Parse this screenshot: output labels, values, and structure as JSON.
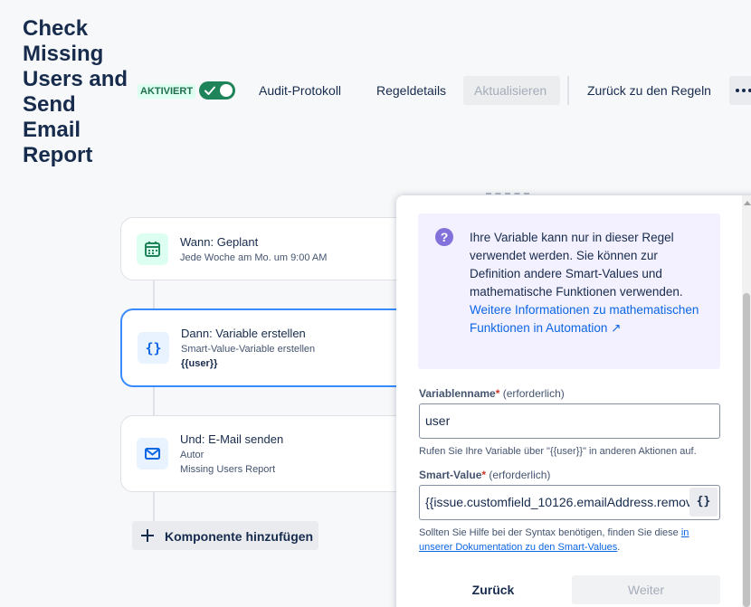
{
  "header": {
    "title": "Check Missing Users and Send Email Report",
    "status_badge": "AKTIVIERT",
    "toggle_on": true,
    "buttons": {
      "audit": "Audit-Protokoll",
      "details": "Regeldetails",
      "update": "Aktualisieren",
      "back": "Zurück zu den Regeln"
    },
    "more_icon": "more-horizontal-icon"
  },
  "flow": {
    "steps": [
      {
        "title": "Wann: Geplant",
        "subtitle": "Jede Woche am Mo. um 9:00 AM",
        "icon": "calendar-icon"
      },
      {
        "title": "Dann: Variable erstellen",
        "subtitle": "Smart-Value-Variable erstellen",
        "detail": "{{user}}",
        "icon": "braces-icon"
      },
      {
        "title": "Und: E-Mail senden",
        "subtitle": "Autor",
        "detail": "Missing Users Report",
        "icon": "mail-icon"
      }
    ],
    "add_component": "Komponente hinzufügen"
  },
  "panel": {
    "info": {
      "text": "Ihre Variable kann nur in dieser Regel verwendet werden. Sie können zur Definition andere Smart-Values und mathematische Funktionen verwenden.",
      "link": "Weitere Informationen zu mathematischen Funktionen in Automation ↗"
    },
    "variable_name": {
      "label": "Variablenname",
      "required_mark": "*",
      "optional_note": "(erforderlich)",
      "value": "user",
      "helper": "Rufen Sie Ihre Variable über \"{{user}}\" in anderen Aktionen auf."
    },
    "smart_value": {
      "label": "Smart-Value",
      "required_mark": "*",
      "optional_note": "(erforderlich)",
      "value": "{{issue.customfield_10126.emailAddress.remov",
      "braces_label": "{}",
      "helper_text": "Sollten Sie Hilfe bei der Syntax benötigen, finden Sie diese",
      "helper_link": "in unserer Dokumentation zu den Smart-Values",
      "helper_end": "."
    },
    "footer": {
      "back": "Zurück",
      "next": "Weiter"
    }
  },
  "colors": {
    "toggle": "#1f845a",
    "selected_border": "#388bff",
    "info_bg": "#f3f0ff",
    "link": "#0c66e4",
    "required": "#c9372c"
  }
}
